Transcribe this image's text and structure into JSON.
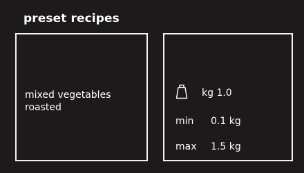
{
  "header": {
    "title": "preset recipes"
  },
  "recipe": {
    "name": "mixed vegetables roasted"
  },
  "details": {
    "weight_label": "kg 1.0",
    "min_label": "min",
    "min_value": "0.1 kg",
    "max_label": "max",
    "max_value": "1.5 kg"
  },
  "icons": {
    "weight": "weight-icon"
  },
  "colors": {
    "background": "#1c1a1b",
    "foreground": "#ffffff",
    "border": "#f2f2f2"
  }
}
